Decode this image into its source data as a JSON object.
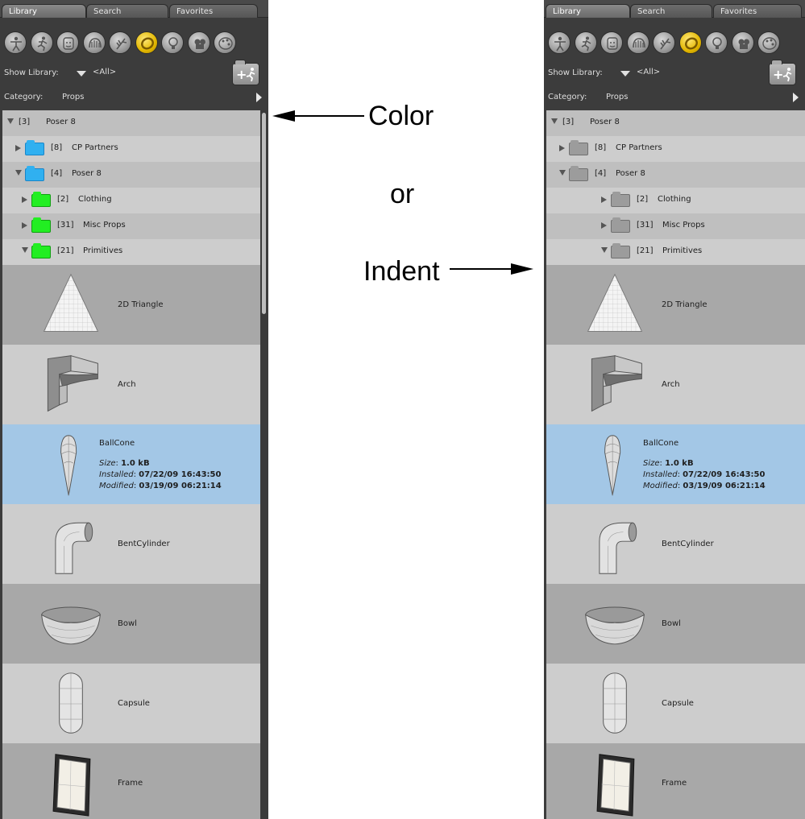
{
  "tabs": [
    "Library",
    "Search",
    "Favorites"
  ],
  "category_icons": [
    "figures-icon",
    "poses-icon",
    "expressions-icon",
    "hair-icon",
    "hands-icon",
    "props-icon",
    "lights-icon",
    "cameras-icon",
    "materials-icon"
  ],
  "active_icon": "props-icon",
  "show_library": {
    "label": "Show Library:",
    "value": "<All>"
  },
  "category": {
    "label": "Category:",
    "value": "Props"
  },
  "tree": [
    {
      "count": "[3]",
      "name": "Poser 8",
      "expand": "down",
      "folder": "none",
      "level": 0
    },
    {
      "count": "[8]",
      "name": "CP Partners",
      "expand": "right",
      "folder": "blue",
      "level": 1
    },
    {
      "count": "[4]",
      "name": "Poser 8",
      "expand": "down",
      "folder": "blue",
      "level": 1
    },
    {
      "count": "[2]",
      "name": "Clothing",
      "expand": "right",
      "folder": "green",
      "level": 2
    },
    {
      "count": "[31]",
      "name": "Misc Props",
      "expand": "right",
      "folder": "green",
      "level": 2
    },
    {
      "count": "[21]",
      "name": "Primitives",
      "expand": "down",
      "folder": "green",
      "level": 2
    }
  ],
  "items": [
    {
      "name": "2D Triangle",
      "shape": "triangle"
    },
    {
      "name": "Arch",
      "shape": "arch"
    },
    {
      "name": "BallCone",
      "shape": "ballcone",
      "selected": true
    },
    {
      "name": "BentCylinder",
      "shape": "bentcyl"
    },
    {
      "name": "Bowl",
      "shape": "bowl"
    },
    {
      "name": "Capsule",
      "shape": "capsule"
    },
    {
      "name": "Frame",
      "shape": "frame"
    }
  ],
  "selected_meta": {
    "size_label": "Size",
    "size_value": "1.0 kB",
    "installed_label": "Installed",
    "installed_value": "07/22/09 16:43:50",
    "modified_label": "Modified",
    "modified_value": "03/19/09 06:21:14"
  },
  "annotations": {
    "color": "Color",
    "or": "or",
    "indent": "Indent"
  },
  "colors": {
    "panel": "#3c3c3c",
    "folder_blue": "#30b0f0",
    "folder_green": "#22ee22",
    "folder_gray": "#9c9c9c",
    "selection": "#a3c7e6",
    "active_icon": "#e2b600"
  }
}
